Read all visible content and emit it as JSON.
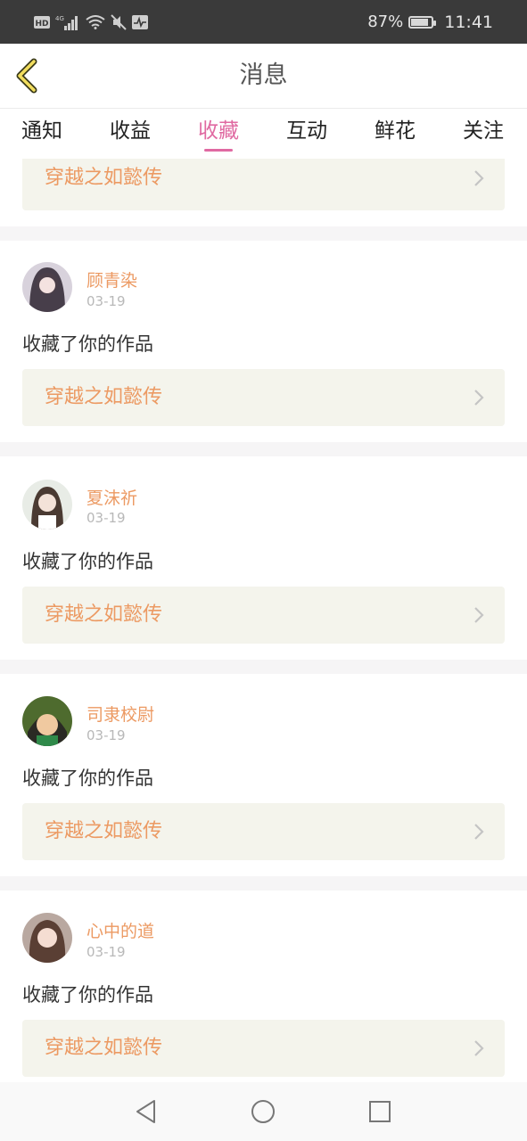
{
  "status_bar": {
    "left_icons": [
      "hd-icon",
      "signal-4g-icon",
      "wifi-icon",
      "mute-icon",
      "activity-icon"
    ],
    "network_label": "4G",
    "hd_label": "HD",
    "battery": "87%",
    "battery_level": 0.87,
    "time": "11:41"
  },
  "header": {
    "title": "消息"
  },
  "tabs": [
    {
      "label": "通知",
      "active": false
    },
    {
      "label": "收益",
      "active": false
    },
    {
      "label": "收藏",
      "active": true
    },
    {
      "label": "互动",
      "active": false
    },
    {
      "label": "鲜花",
      "active": false
    },
    {
      "label": "关注",
      "active": false
    }
  ],
  "top_card": {
    "work_title": "穿越之如懿传"
  },
  "items": [
    {
      "user": "顾青染",
      "date": "03-19",
      "action": "收藏了你的作品",
      "work_title": "穿越之如懿传"
    },
    {
      "user": "夏沫祈",
      "date": "03-19",
      "action": "收藏了你的作品",
      "work_title": "穿越之如懿传"
    },
    {
      "user": "司隶校尉",
      "date": "03-19",
      "action": "收藏了你的作品",
      "work_title": "穿越之如懿传"
    },
    {
      "user": "心中的道",
      "date": "03-19",
      "action": "收藏了你的作品",
      "work_title": "穿越之如懿传"
    }
  ],
  "colors": {
    "accent": "#e06aa2",
    "work_text": "#ec9a63",
    "card_bg": "#f4f4ec"
  }
}
